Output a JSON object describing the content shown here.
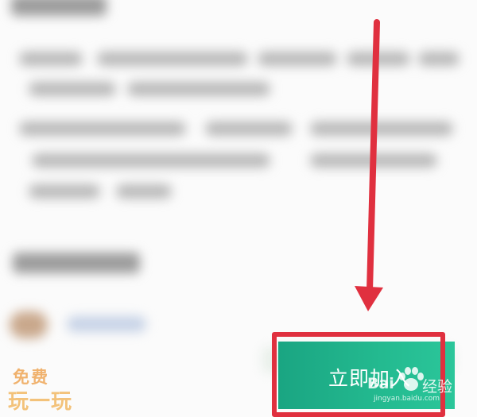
{
  "join_button": {
    "label": "立即加入"
  },
  "watermark": {
    "brand_left": "Bai",
    "brand_right": "经验",
    "url": "jingyan.baidu.com"
  },
  "promo": {
    "line1": "免费",
    "line2": "玩一玩"
  },
  "colors": {
    "button": "#1fae87",
    "highlight": "#e0303f",
    "promo": "#f0b26e"
  },
  "icons": {
    "arrow": "down-arrow-icon",
    "watermark": "paw-icon"
  }
}
